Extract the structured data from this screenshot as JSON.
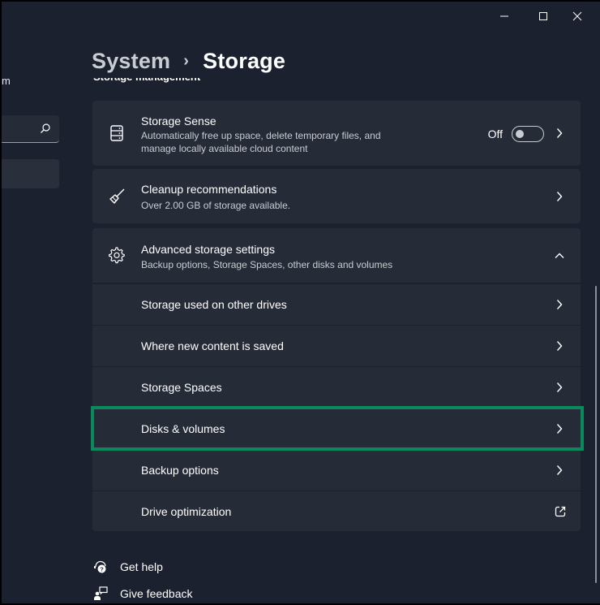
{
  "window": {
    "caption_buttons": [
      "minimize",
      "maximize",
      "close"
    ]
  },
  "nav": {
    "user_fragment": "m",
    "search_placeholder": "",
    "search_icon": "search-icon"
  },
  "header": {
    "breadcrumb_parent": "System",
    "breadcrumb_separator": "›",
    "breadcrumb_current": "Storage"
  },
  "section": {
    "title": "Storage management"
  },
  "cards": {
    "storage_sense": {
      "icon": "storage-drive-icon",
      "title": "Storage Sense",
      "description": "Automatically free up space, delete temporary files, and manage locally available cloud content",
      "toggle_label": "Off",
      "toggle_on": false
    },
    "cleanup": {
      "icon": "broom-icon",
      "title": "Cleanup recommendations",
      "description": "Over 2.00 GB of storage available."
    },
    "advanced": {
      "icon": "gear-icon",
      "title": "Advanced storage settings",
      "description": "Backup options, Storage Spaces, other disks and volumes",
      "expanded": true
    }
  },
  "advanced_items": [
    {
      "label": "Storage used on other drives",
      "trailing": "chevron-right"
    },
    {
      "label": "Where new content is saved",
      "trailing": "chevron-right"
    },
    {
      "label": "Storage Spaces",
      "trailing": "chevron-right"
    },
    {
      "label": "Disks & volumes",
      "trailing": "chevron-right",
      "highlighted": true
    },
    {
      "label": "Backup options",
      "trailing": "chevron-right"
    },
    {
      "label": "Drive optimization",
      "trailing": "external-link"
    }
  ],
  "footer": {
    "get_help": "Get help",
    "give_feedback": "Give feedback"
  },
  "colors": {
    "background": "#1c2130",
    "card": "#262b38",
    "highlight": "#0a8a5c",
    "text_primary": "#ffffff",
    "text_secondary": "#c9ccd1"
  }
}
